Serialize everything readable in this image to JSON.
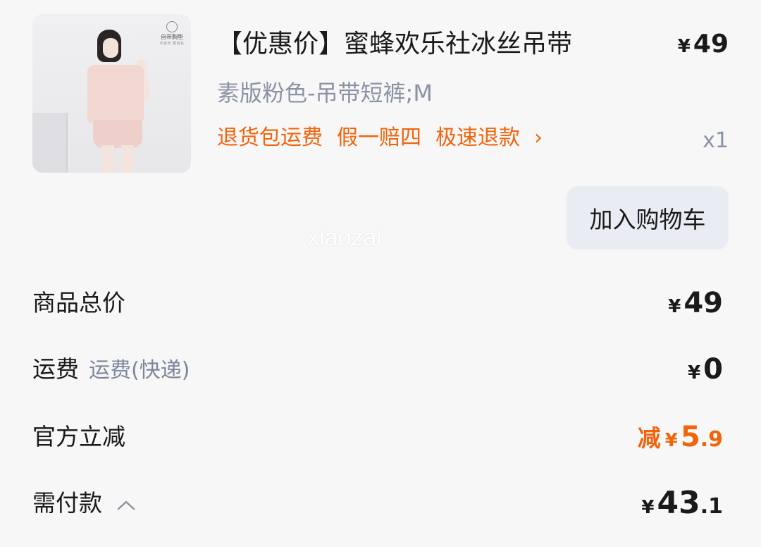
{
  "product": {
    "title": "【优惠价】蜜蜂欢乐社冰丝吊带",
    "price_symbol": "¥",
    "price": "49",
    "variant": "素版粉色-吊带短裤;M",
    "services": [
      "退货包运费",
      "假一赔四",
      "极速退款"
    ],
    "services_arrow": "›",
    "quantity": "x1",
    "cart_button_label": "加入购物车",
    "image_icon": "product-photo",
    "brand_logo": {
      "name": "自带胸垫",
      "tagline": "不走光 更自在"
    }
  },
  "watermark": "xiaozai",
  "summary": {
    "total_goods": {
      "label": "商品总价",
      "symbol": "¥",
      "amount": "49"
    },
    "shipping": {
      "label": "运费",
      "sub_label": "运费(快递)",
      "symbol": "¥",
      "amount": "0"
    },
    "official_discount": {
      "label": "官方立减",
      "prefix": "减",
      "symbol": "¥",
      "amount_int": "5",
      "amount_dec": ".9"
    },
    "payable": {
      "label": "需付款",
      "caret_icon": "chevron-up-icon",
      "symbol": "¥",
      "amount_int": "43",
      "amount_dec": ".1"
    }
  },
  "colors": {
    "accent_orange": "#f2640a",
    "secondary_text": "#8b93a3",
    "button_bg": "#e9edf3",
    "background": "#f7f7f8"
  }
}
